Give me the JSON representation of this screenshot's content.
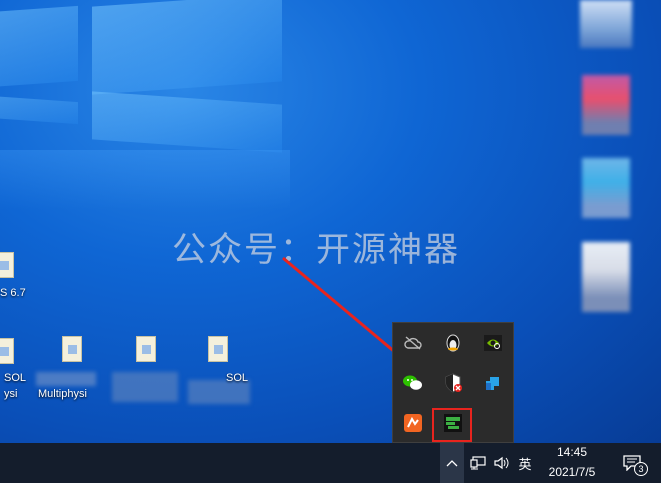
{
  "watermark": "公众号：开源神器",
  "desktop_icons": [
    {
      "label": "S 6.7"
    },
    {
      "label": "SOL"
    },
    {
      "label": "ysi"
    },
    {
      "label": "Multiphysi"
    },
    {
      "label": "SOL"
    }
  ],
  "tray_popup": {
    "icons": [
      "cloud-offline-icon",
      "penguin-icon",
      "nvidia-icon",
      "wechat-icon",
      "shield-icon",
      "arrow-app-icon",
      "orange-app-icon",
      "green-app-icon"
    ]
  },
  "taskbar": {
    "chevron": "^",
    "input_method": "英",
    "time": "14:45",
    "date": "2021/7/5",
    "notification_count": "3"
  }
}
